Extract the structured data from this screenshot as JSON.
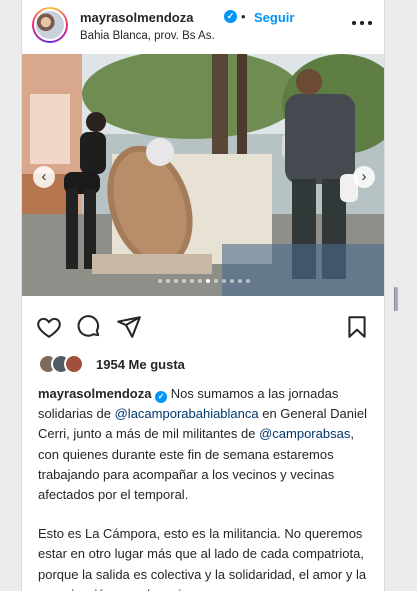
{
  "post": {
    "username": "mayrasolmendoza",
    "dot_separator": "•",
    "follow_label": "Seguir",
    "location": "Bahia Blanca, prov. Bs As.",
    "verified_icon": "verified-badge-icon",
    "more_icon": "more-options-icon"
  },
  "media": {
    "prev_arrow": "‹",
    "next_arrow": "›",
    "slide_count": 12,
    "active_slide": 7
  },
  "actions": {
    "like_icon": "heart-icon",
    "comment_icon": "comment-icon",
    "share_icon": "share-icon",
    "save_icon": "bookmark-icon"
  },
  "likes": {
    "count": "1954",
    "label": "Me gusta"
  },
  "caption": {
    "username": "mayrasolmendoza",
    "part1": "Nos sumamos a las jornadas solidarias de ",
    "mention1": "@lacamporabahiablanca",
    "part2": " en General Daniel Cerri, junto a más de mil militantes de ",
    "mention2": "@camporabsas",
    "part3": ", con quienes durante este fin de semana estaremos trabajando para acompañar a los vecinos y vecinas afectados por el temporal.",
    "paragraph2": "Esto es La Cámpora, esto es la militancia. No queremos estar en otro lugar más que al lado de cada compatriota, porque la salida es colectiva y la solidaridad, el amor y la organización son el camino."
  },
  "colors": {
    "accent": "#0095f6",
    "text": "#262626",
    "mention": "#00376b"
  }
}
